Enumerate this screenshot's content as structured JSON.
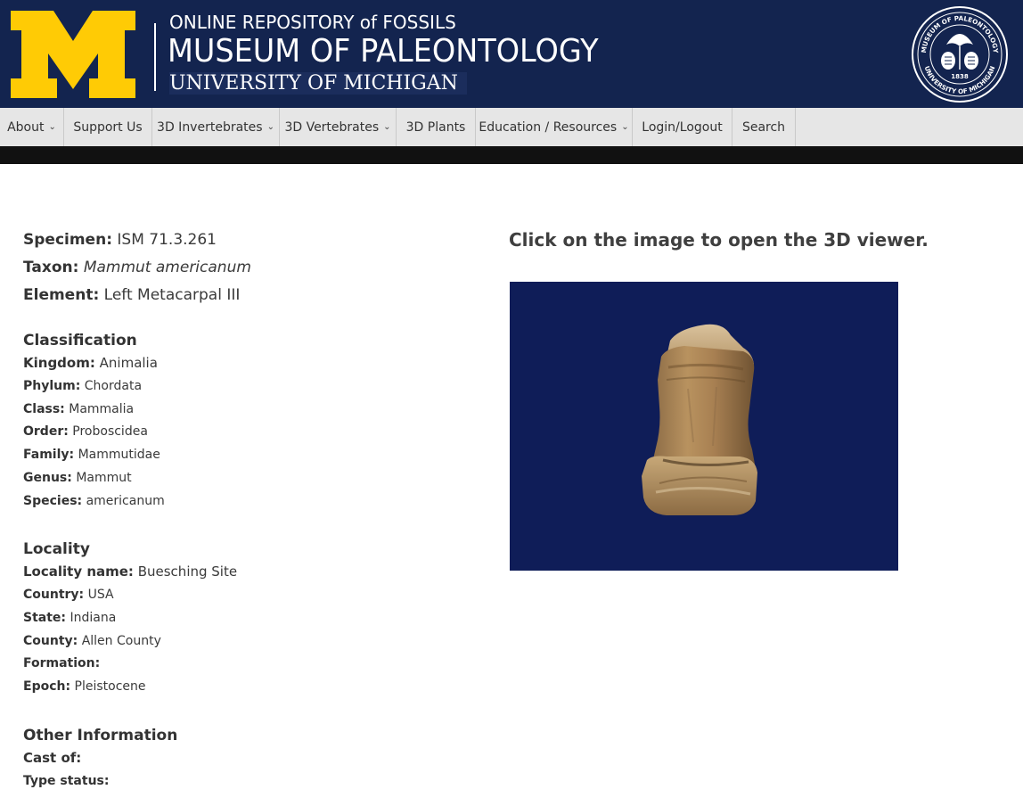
{
  "header": {
    "line1": "ONLINE REPOSITORY of FOSSILS",
    "line2": "MUSEUM OF PALEONTOLOGY",
    "line3": "UNIVERSITY OF MICHIGAN",
    "seal_top": "MUSEUM OF PALEONTOLOGY",
    "seal_bottom": "UNIVERSITY OF MICHIGAN",
    "seal_year": "1838",
    "logo_icon": "block-m-logo",
    "seal_icon": "museum-seal"
  },
  "colors": {
    "header_bg": "#13244f",
    "maize": "#ffcb05",
    "nav_bg": "#e6e6e6",
    "viewer_bg": "#0f1d58"
  },
  "nav": [
    {
      "label": "About",
      "dropdown": true
    },
    {
      "label": "Support Us",
      "dropdown": false
    },
    {
      "label": "3D Invertebrates",
      "dropdown": true
    },
    {
      "label": "3D Vertebrates",
      "dropdown": true
    },
    {
      "label": "3D Plants",
      "dropdown": false
    },
    {
      "label": "Education / Resources",
      "dropdown": true
    },
    {
      "label": "Login/Logout",
      "dropdown": false
    },
    {
      "label": "Search",
      "dropdown": false
    }
  ],
  "specimen": {
    "specimen_label": "Specimen:",
    "specimen_value": "ISM 71.3.261",
    "taxon_label": "Taxon:",
    "taxon_value": "Mammut americanum",
    "element_label": "Element:",
    "element_value": "Left Metacarpal III"
  },
  "classification": {
    "heading": "Classification",
    "kingdom_label": "Kingdom:",
    "kingdom_value": "Animalia",
    "phylum_label": "Phylum:",
    "phylum_value": "Chordata",
    "class_label": "Class:",
    "class_value": "Mammalia",
    "order_label": "Order:",
    "order_value": "Proboscidea",
    "family_label": "Family:",
    "family_value": "Mammutidae",
    "genus_label": "Genus:",
    "genus_value": "Mammut",
    "species_label": "Species:",
    "species_value": "americanum"
  },
  "locality": {
    "heading": "Locality",
    "name_label": "Locality name:",
    "name_value": "Buesching Site",
    "country_label": "Country:",
    "country_value": "USA",
    "state_label": "State:",
    "state_value": "Indiana",
    "county_label": "County:",
    "county_value": "Allen County",
    "formation_label": "Formation:",
    "formation_value": "",
    "epoch_label": "Epoch:",
    "epoch_value": "Pleistocene"
  },
  "other": {
    "heading": "Other Information",
    "cast_label": "Cast of:",
    "cast_value": "",
    "type_label": "Type status:",
    "type_value": ""
  },
  "viewer": {
    "caption": "Click on the image to open the 3D viewer.",
    "image_icon": "metacarpal-fossil-image"
  }
}
